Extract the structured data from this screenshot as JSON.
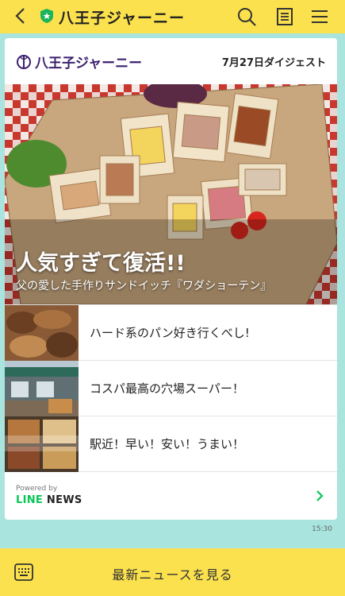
{
  "header": {
    "title": "八王子ジャーニー",
    "icons": [
      "back-arrow-icon",
      "verified-shield-icon",
      "search-icon",
      "notes-icon",
      "menu-icon"
    ]
  },
  "card": {
    "brand_name": "八王子ジャーニー",
    "digest_date": "7月27日ダイジェスト",
    "hero": {
      "headline": "人気すぎて復活!!",
      "subtitle": "父の愛した手作りサンドイッチ『ワダショーテン』"
    },
    "items": [
      {
        "title": "ハード系のパン好き行くべし!"
      },
      {
        "title": "コスパ最高の穴場スーパー！"
      },
      {
        "title": "駅近！早い！安い！うまい！"
      }
    ],
    "powered_by": "Powered by",
    "provider_line": "LINE",
    "provider_news": "NEWS"
  },
  "timestamp": "15:30",
  "bottom_bar": {
    "latest_label": "最新ニュースを見る"
  },
  "colors": {
    "header_bg": "#fbe14d",
    "page_bg": "#a9e4de",
    "brand_purple": "#3b1f6e",
    "line_green": "#06c755"
  }
}
